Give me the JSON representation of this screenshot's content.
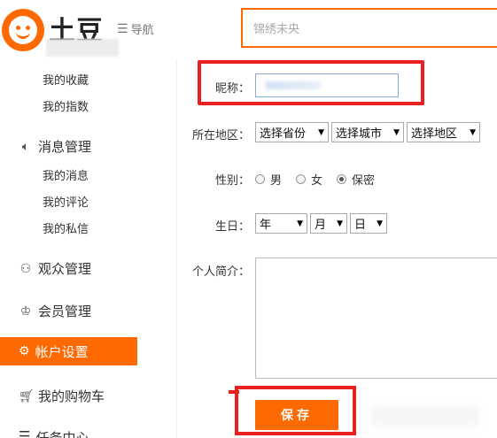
{
  "header": {
    "logo_text": "土豆",
    "nav_label": "导航",
    "search_placeholder": "锦绣未央"
  },
  "sidebar": {
    "sub_top": [
      "我的收藏",
      "我的指数"
    ],
    "message_mgmt": "消息管理",
    "message_items": [
      "我的消息",
      "我的评论",
      "我的私信"
    ],
    "audience_mgmt": "观众管理",
    "member_mgmt": "会员管理",
    "account_settings": "帐户设置",
    "cart": "我的购物车",
    "task_center": "任务中心"
  },
  "form": {
    "nickname_label": "昵称：",
    "region_label": "所在地区：",
    "province_select": "选择省份",
    "city_select": "选择城市",
    "district_select": "选择地区",
    "gender_label": "性别：",
    "gender_options": [
      "男",
      "女",
      "保密"
    ],
    "gender_selected": "保密",
    "birthday_label": "生日：",
    "year_select": "年",
    "month_select": "月",
    "day_select": "日",
    "bio_label": "个人简介：",
    "save_button": "保存"
  },
  "colors": {
    "brand": "#ff6a00",
    "annotation_red": "#e8201f"
  }
}
